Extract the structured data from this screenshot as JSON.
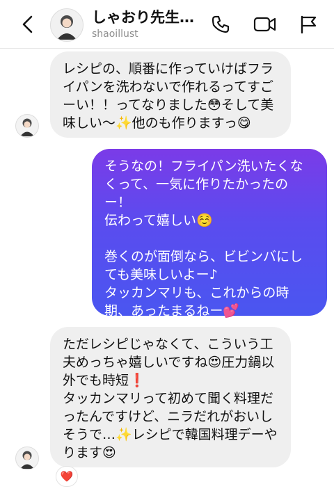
{
  "header": {
    "title": "しゃおり先生…",
    "username": "shaoillust",
    "icons": [
      "back-arrow-icon",
      "avatar",
      "phone-icon",
      "video-camera-icon",
      "flag-icon"
    ]
  },
  "messages": [
    {
      "direction": "incoming",
      "text": "レシピの、順番に作っていけばフライパンを洗わないで作れるってすごーい！！ってなりました😳そして美味しい〜✨他のも作りますっ😋"
    },
    {
      "direction": "outgoing",
      "text": "そうなの！フライパン洗いたくなくって、一気に作りたかったのー！\n伝わって嬉しい☺️\n\n巻くのが面倒なら、ビビンバにしても美味しいよー♪\nタッカンマリも、これからの時期、あったまるねー💕"
    },
    {
      "direction": "incoming",
      "text": "ただレシピじゃなくて、こういう工夫めっちゃ嬉しいですね😍圧力鍋以外でも時短❗️\nタッカンマリって初めて聞く料理だったんですけど、ニラだれがおいしそうで…✨レシピで韓国料理デーやります😍",
      "reaction": "❤️"
    }
  ],
  "colors": {
    "incoming_bubble": "#efefef",
    "outgoing_gradient_top": "#7b3be8",
    "outgoing_gradient_bottom": "#4a56f0",
    "subtitle": "#8e8e8e"
  }
}
